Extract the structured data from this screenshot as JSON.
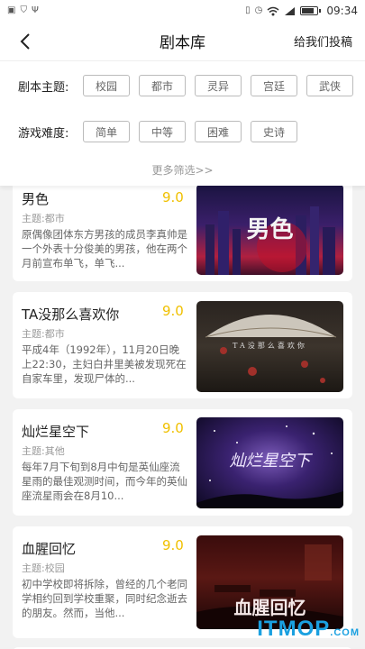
{
  "status_bar": {
    "time": "09:34"
  },
  "header": {
    "title": "剧本库",
    "action": "给我们投稿"
  },
  "filters": {
    "theme_label": "剧本主题:",
    "theme_options": [
      "校园",
      "都市",
      "灵异",
      "宫廷",
      "武侠"
    ],
    "difficulty_label": "游戏难度:",
    "difficulty_options": [
      "简单",
      "中等",
      "困难",
      "史诗"
    ],
    "more": "更多筛选>>"
  },
  "scripts": [
    {
      "title": "男色",
      "score": "9.0",
      "theme": "主题:都市",
      "desc": "原偶像团体东方男孩的成员李真帅是一个外表十分俊美的男孩，他在两个月前宣布单飞，单飞...",
      "cover_text": "男色"
    },
    {
      "title": "TA没那么喜欢你",
      "score": "9.0",
      "theme": "主题:都市",
      "desc": "平成4年（1992年），11月20日晚上22:30，主妇白井里美被发现死在自家车里，发现尸体的...",
      "cover_text": "TA没那么喜欢你"
    },
    {
      "title": "灿烂星空下",
      "score": "9.0",
      "theme": "主题:其他",
      "desc": "每年7月下旬到8月中旬是英仙座流星雨的最佳观测时间，而今年的英仙座流星雨会在8月10...",
      "cover_text": "灿烂星空下"
    },
    {
      "title": "血腥回忆",
      "score": "9.0",
      "theme": "主题:校园",
      "desc": "初中学校即将拆除，曾经的几个老同学相约回到学校重聚，同时纪念逝去的朋友。然而，当他...",
      "cover_text": "血腥回忆"
    }
  ],
  "watermark": {
    "main": "ITMOP",
    "suffix": ".COM"
  }
}
